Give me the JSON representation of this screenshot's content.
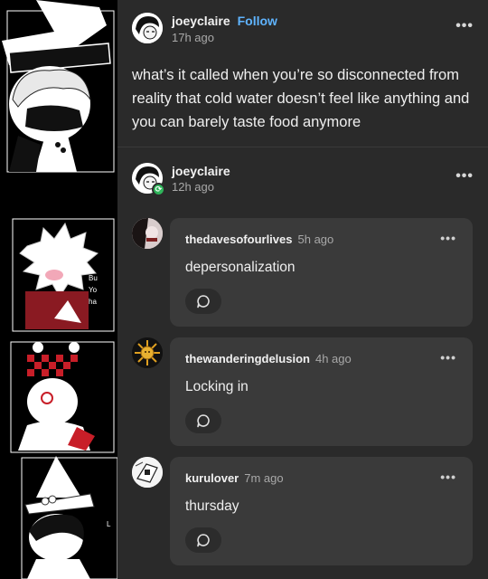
{
  "post": {
    "username": "joeyclaire",
    "follow_label": "Follow",
    "time": "17h ago",
    "more": "•••",
    "body": "what’s it called when you’re so disconnected from reality that cold water doesn’t feel like anything and you can barely taste food anymore"
  },
  "reblog": {
    "username": "joeyclaire",
    "time": "12h ago",
    "more": "•••",
    "badge": "⟳"
  },
  "replies": [
    {
      "username": "thedavesofourlives",
      "time": "5h ago",
      "text": "depersonalization",
      "more": "•••"
    },
    {
      "username": "thewanderingdelusion",
      "time": "4h ago",
      "text": "Locking in",
      "more": "•••"
    },
    {
      "username": "kurulover",
      "time": "7m ago",
      "text": "thursday",
      "more": "•••"
    }
  ],
  "art_strip": {
    "side_text": [
      "Bu",
      "Yo",
      "ha"
    ],
    "corner_text": "L"
  },
  "colors": {
    "feed_bg": "#2a2a2a",
    "card_bg": "#3a3a3a",
    "follow": "#5fb4ff",
    "reblog_badge": "#2fb45a",
    "accent_red": "#c81e28"
  }
}
